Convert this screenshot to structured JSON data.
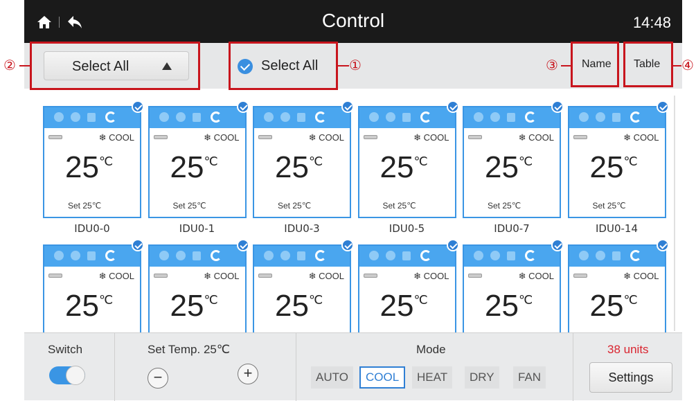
{
  "header": {
    "title": "Control",
    "time": "14:48"
  },
  "toolbar": {
    "dropdown_label": "Select All",
    "select_all_label": "Select All",
    "sort_name": "Name",
    "sort_table": "Table"
  },
  "annotations": [
    "①",
    "②",
    "③",
    "④"
  ],
  "cards": [
    {
      "name": "IDU0-0",
      "mode": "❄ COOL",
      "temp": "25",
      "unit": "℃",
      "set": "Set  25℃"
    },
    {
      "name": "IDU0-1",
      "mode": "❄ COOL",
      "temp": "25",
      "unit": "℃",
      "set": "Set  25℃"
    },
    {
      "name": "IDU0-3",
      "mode": "❄ COOL",
      "temp": "25",
      "unit": "℃",
      "set": "Set  25℃"
    },
    {
      "name": "IDU0-5",
      "mode": "❄ COOL",
      "temp": "25",
      "unit": "℃",
      "set": "Set  25℃"
    },
    {
      "name": "IDU0-7",
      "mode": "❄ COOL",
      "temp": "25",
      "unit": "℃",
      "set": "Set  25℃"
    },
    {
      "name": "IDU0-14",
      "mode": "❄ COOL",
      "temp": "25",
      "unit": "℃",
      "set": "Set  25℃"
    },
    {
      "name": "",
      "mode": "❄ COOL",
      "temp": "25",
      "unit": "℃",
      "set": ""
    },
    {
      "name": "",
      "mode": "❄ COOL",
      "temp": "25",
      "unit": "℃",
      "set": ""
    },
    {
      "name": "",
      "mode": "❄ COOL",
      "temp": "25",
      "unit": "℃",
      "set": ""
    },
    {
      "name": "",
      "mode": "❄ COOL",
      "temp": "25",
      "unit": "℃",
      "set": ""
    },
    {
      "name": "",
      "mode": "❄ COOL",
      "temp": "25",
      "unit": "℃",
      "set": ""
    },
    {
      "name": "",
      "mode": "❄ COOL",
      "temp": "25",
      "unit": "℃",
      "set": ""
    }
  ],
  "bottom": {
    "switch_label": "Switch",
    "switch_on": true,
    "set_temp_label": "Set Temp. 25℃",
    "minus": "−",
    "plus": "+",
    "mode_label": "Mode",
    "modes": [
      "AUTO",
      "COOL",
      "HEAT",
      "DRY",
      "FAN"
    ],
    "active_mode": "COOL",
    "units": "38 units",
    "settings_label": "Settings"
  },
  "colors": {
    "accent": "#3a95e4",
    "header_bg": "#1a1a1a",
    "annotation": "#c8151d",
    "units_text": "#d9242f"
  }
}
